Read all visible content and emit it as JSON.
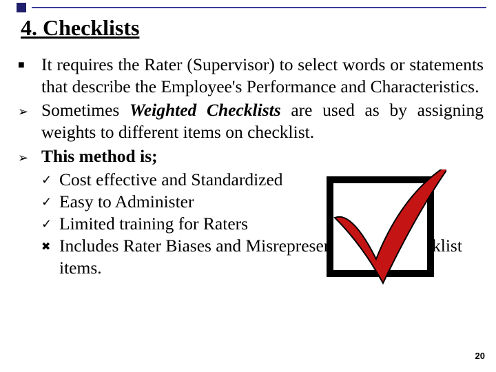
{
  "title": "4. Checklists",
  "bullets": [
    {
      "type": "square",
      "text": "It requires the Rater (Supervisor) to select words or statements that describe the Employee's Performance and Characteristics."
    },
    {
      "type": "arrow",
      "text_pre": "Sometimes ",
      "text_em": "Weighted Checklists",
      "text_post": " are used as by assigning weights to different items on checklist."
    },
    {
      "type": "arrow",
      "text_b": "This method is;",
      "sub": [
        {
          "mark": "check",
          "text": "Cost effective and Standardized"
        },
        {
          "mark": "check",
          "text": "Easy to Administer"
        },
        {
          "mark": "check",
          "text": "Limited training for Raters"
        },
        {
          "mark": "cross",
          "text": "Includes Rater Biases and Misrepresentation of Checklist items."
        }
      ]
    }
  ],
  "image_alt": "checkbox-with-red-checkmark",
  "page_number": "20"
}
